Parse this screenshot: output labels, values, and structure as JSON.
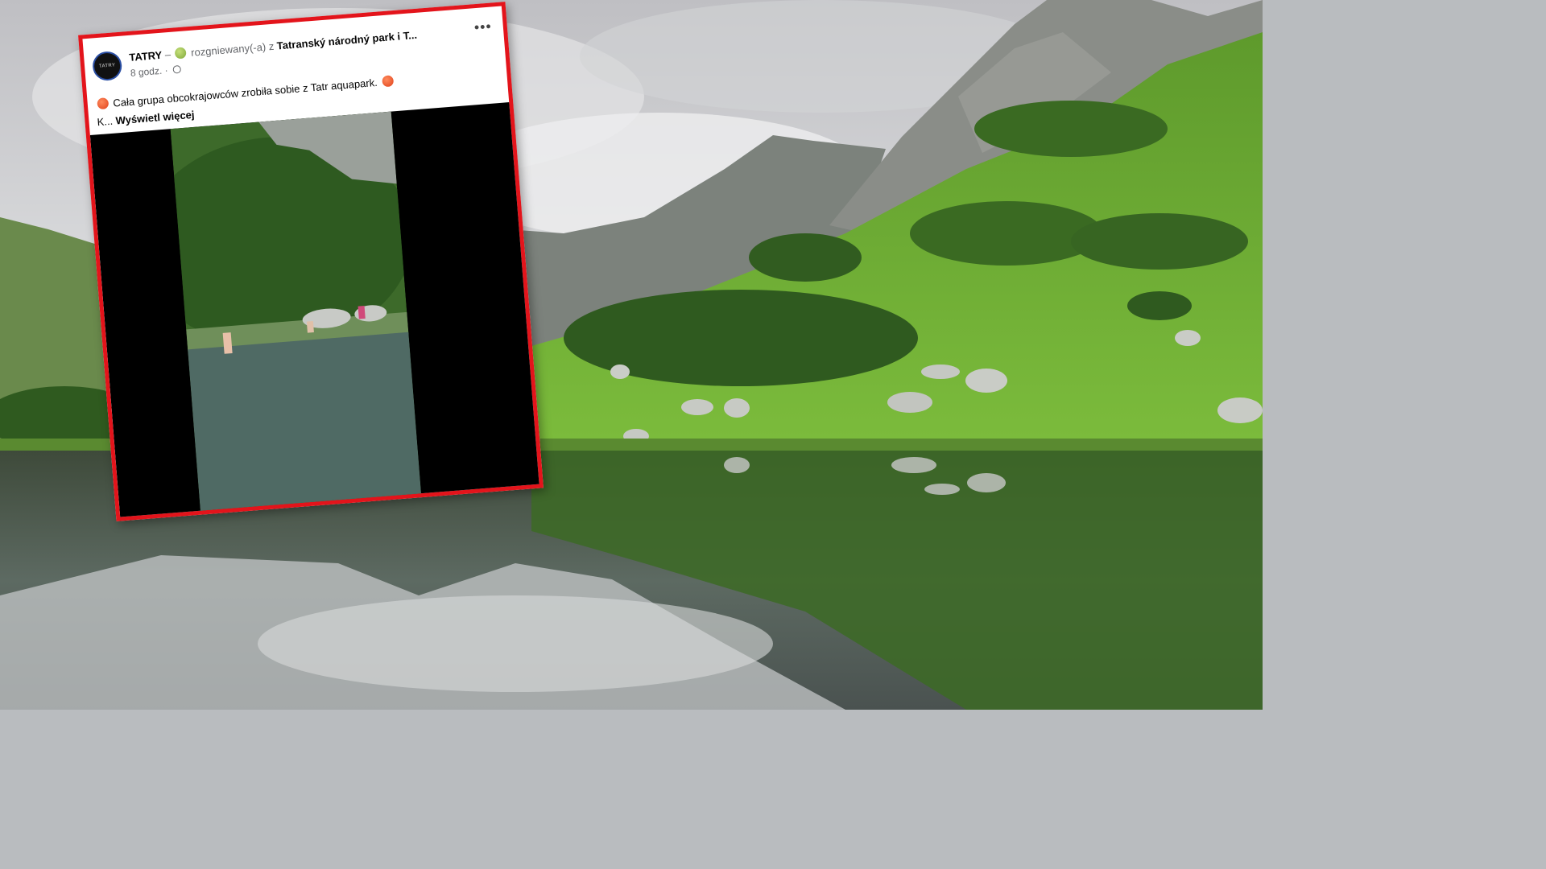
{
  "post": {
    "page_name": "TATRY",
    "separator": "–",
    "feeling": "rozgniewany(-a)",
    "location_prefix": "z",
    "location": "Tatranský národný park i T...",
    "time": "8 godz.",
    "body": "Cała grupa obcokrajowców zrobiła sobie z Tatr aquapark.",
    "continuation": "K...",
    "see_more": "Wyświetl więcej",
    "avatar_text": "TATRY"
  },
  "colors": {
    "frame_border": "#e3141b",
    "card_bg": "#ffffff"
  },
  "icons": [
    "more-options-icon",
    "globe-icon",
    "angry-emoji-icon",
    "nauseated-emoji-icon"
  ]
}
